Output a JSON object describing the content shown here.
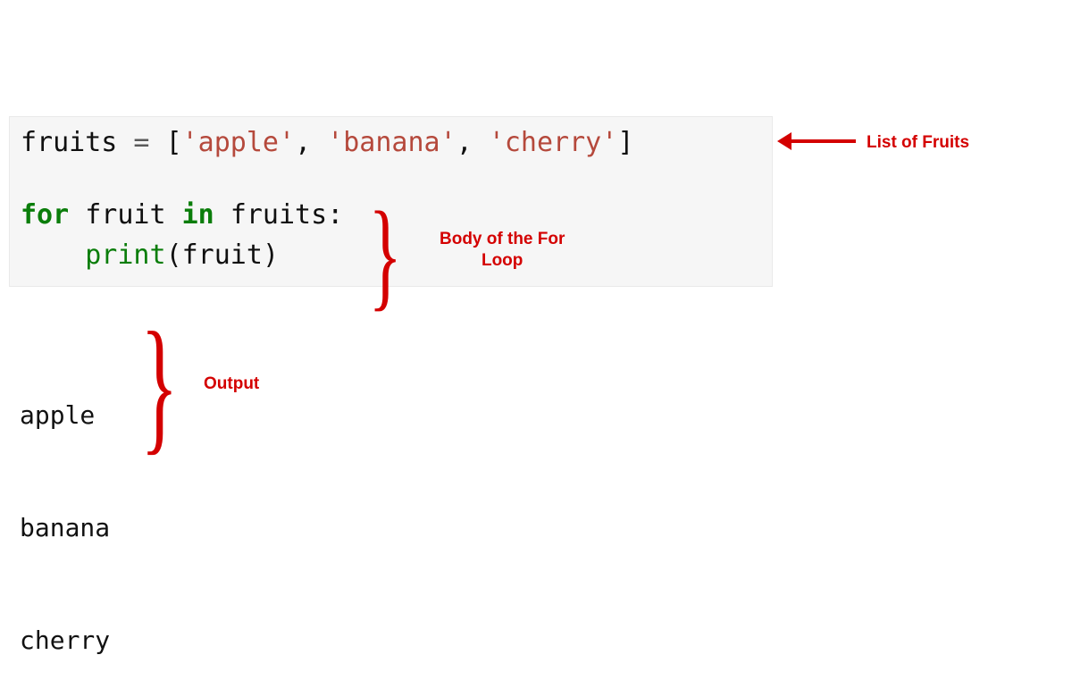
{
  "code": {
    "assign_var": "fruits",
    "assign_op": " = ",
    "open_br": "[",
    "s1": "'apple'",
    "c1": ", ",
    "s2": "'banana'",
    "c2": ", ",
    "s3": "'cherry'",
    "close_br": "]",
    "for_kw": "for",
    "sp1": " ",
    "loop_var": "fruit",
    "sp2": " ",
    "in_kw": "in",
    "sp3": " ",
    "iter_name": "fruits",
    "colon": ":",
    "indent": "    ",
    "print_fn": "print",
    "l_paren": "(",
    "arg": "fruit",
    "r_paren": ")"
  },
  "output": {
    "l1": "apple",
    "l2": "banana",
    "l3": "cherry"
  },
  "annotations": {
    "list_label": "List of Fruits",
    "body_label_l1": "Body of the For",
    "body_label_l2": "Loop",
    "output_label": "Output"
  },
  "braces": {
    "brace_char": "}"
  }
}
